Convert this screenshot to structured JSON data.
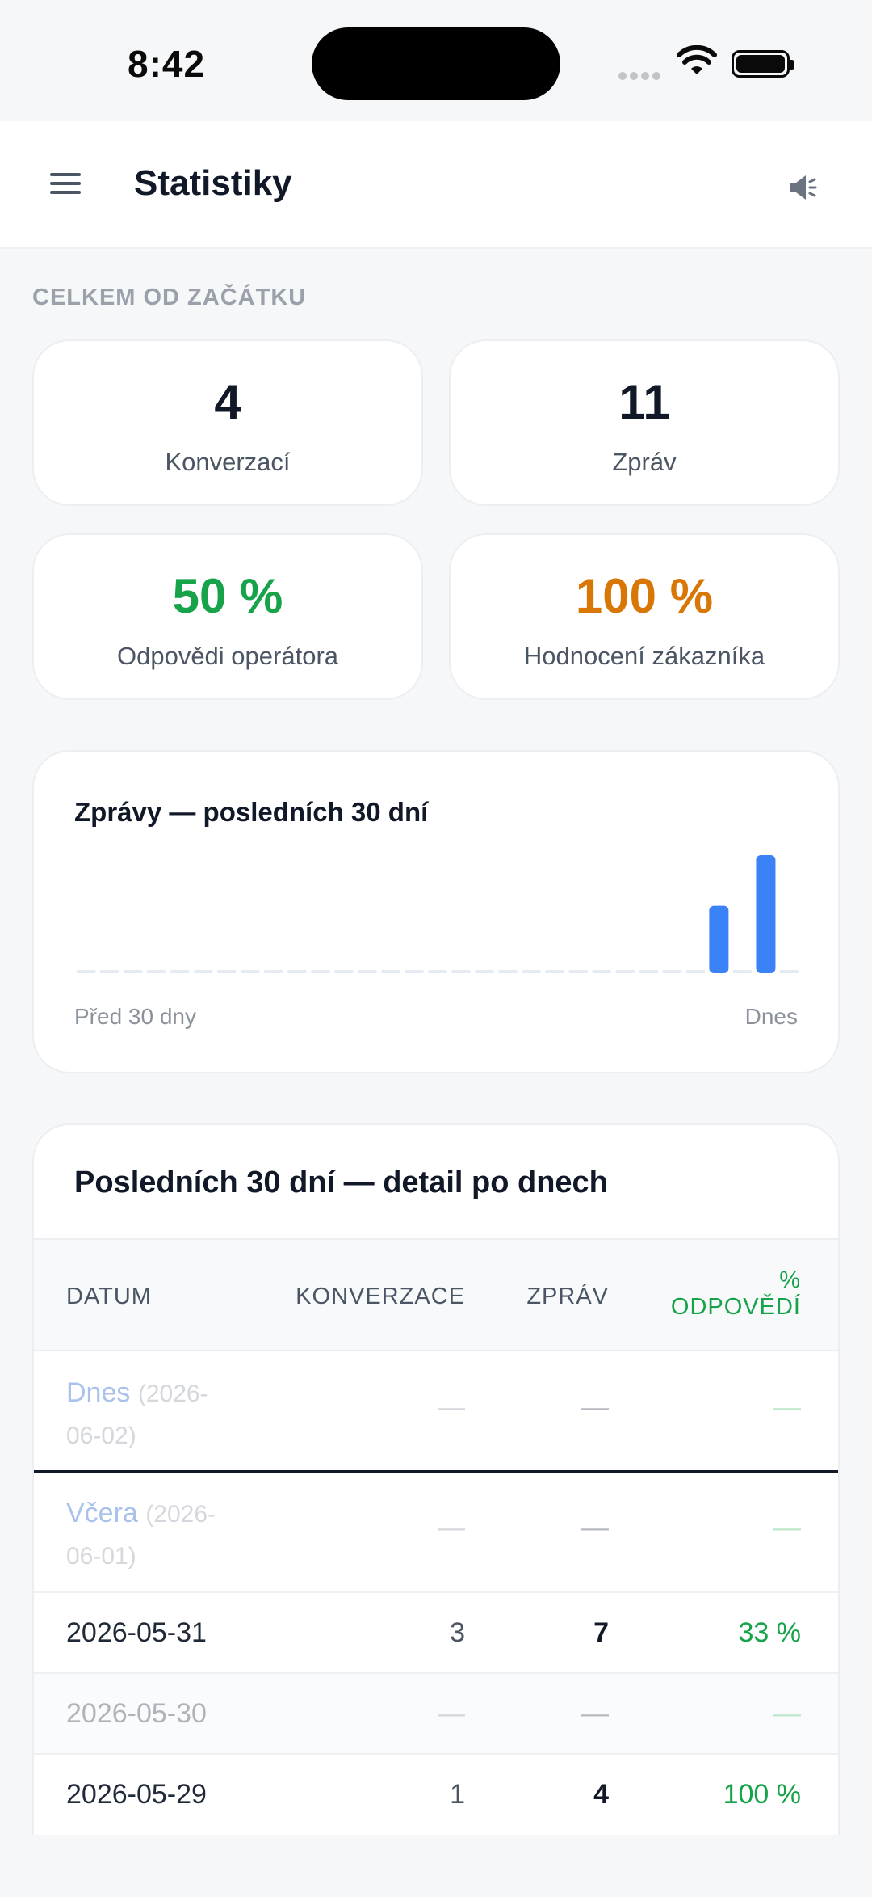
{
  "status_bar": {
    "time": "8:42"
  },
  "header": {
    "title": "Statistiky"
  },
  "overview": {
    "section_label": "CELKEM OD ZAČÁTKU",
    "stats": [
      {
        "value": "4",
        "label": "Konverzací",
        "color": "#111827"
      },
      {
        "value": "11",
        "label": "Zpráv",
        "color": "#111827"
      },
      {
        "value": "50 %",
        "label": "Odpovědi operátora",
        "color": "#16a34a"
      },
      {
        "value": "100 %",
        "label": "Hodnocení zákazníka",
        "color": "#d97706"
      }
    ]
  },
  "chart": {
    "title": "Zprávy — posledních 30 dní",
    "x_start_label": "Před 30 dny",
    "x_end_label": "Dnes"
  },
  "chart_data": {
    "type": "bar",
    "title": "Zprávy — posledních 30 dní",
    "categories": [
      "Před 30 dny",
      "",
      "",
      "",
      "",
      "",
      "",
      "",
      "",
      "",
      "",
      "",
      "",
      "",
      "",
      "",
      "",
      "",
      "",
      "",
      "",
      "",
      "",
      "",
      "",
      "",
      "",
      "",
      "",
      "Dnes"
    ],
    "values": [
      0,
      0,
      0,
      0,
      0,
      0,
      0,
      0,
      0,
      0,
      0,
      0,
      0,
      0,
      0,
      0,
      0,
      0,
      0,
      0,
      0,
      0,
      0,
      0,
      0,
      0,
      0,
      4,
      0,
      7,
      0
    ],
    "bar_color": "#3b82f6",
    "empty_color": "#e6eaf2"
  },
  "table": {
    "title": "Posledních 30 dní — detail po dnech",
    "headers": {
      "date": "DATUM",
      "conversations": "KONVERZACE",
      "messages": "ZPRÁV",
      "response_pct_line1": "%",
      "response_pct_line2": "ODPOVĚDÍ"
    },
    "rows": [
      {
        "label": "Dnes",
        "date": "(2026-",
        "date2": "06-02)",
        "conversations": "—",
        "messages": "—",
        "response_pct": "—"
      },
      {
        "label": "Včera",
        "date": "(2026-",
        "date2": "06-01)",
        "conversations": "—",
        "messages": "—",
        "response_pct": "—"
      },
      {
        "date": "2026-05-31",
        "conversations": "3",
        "messages": "7",
        "response_pct": "33 %"
      },
      {
        "date": "2026-05-30",
        "conversations": "—",
        "messages": "—",
        "response_pct": "—"
      },
      {
        "date": "2026-05-29",
        "conversations": "1",
        "messages": "4",
        "response_pct": "100 %"
      }
    ]
  },
  "colors": {
    "accent_blue": "#3b82f6",
    "green": "#16a34a",
    "orange": "#d97706"
  },
  "icons": {
    "menu": "hamburger-icon",
    "sound": "speaker-icon"
  }
}
